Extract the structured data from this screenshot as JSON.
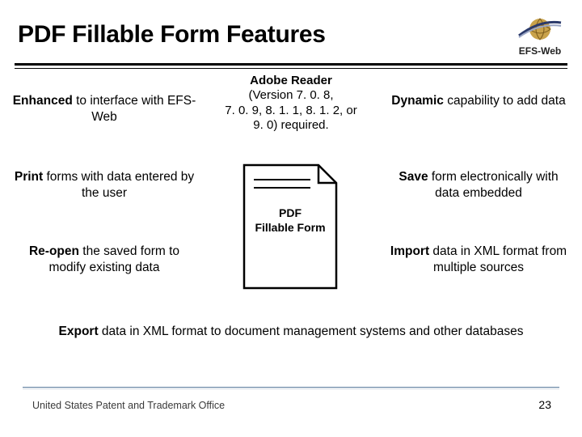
{
  "title": "PDF Fillable Form Features",
  "logo": {
    "text": "EFS-Web"
  },
  "features": {
    "left": [
      {
        "bold": "Enhanced",
        "rest": " to interface with EFS-Web"
      },
      {
        "bold": "Print",
        "rest": " forms with data entered by the user"
      },
      {
        "bold": "Re-open",
        "rest": " the saved form to modify existing data"
      }
    ],
    "right": [
      {
        "bold": "Dynamic",
        "rest": " capability to add data"
      },
      {
        "bold": "Save",
        "rest": " form electronically with data embedded"
      },
      {
        "bold": "Import",
        "rest": " data in XML format from multiple sources"
      }
    ],
    "center_caption": {
      "bold": "Adobe Reader",
      "rest_lines": [
        "(Version 7. 0. 8,",
        "7. 0. 9, 8. 1. 1, 8. 1. 2, or",
        "9. 0) required."
      ]
    },
    "doc_label_lines": [
      "PDF",
      "Fillable Form"
    ],
    "bottom": {
      "bold": "Export",
      "rest": " data in XML format to document management systems and other databases"
    }
  },
  "footer": "United States Patent and Trademark Office",
  "page_number": "23"
}
